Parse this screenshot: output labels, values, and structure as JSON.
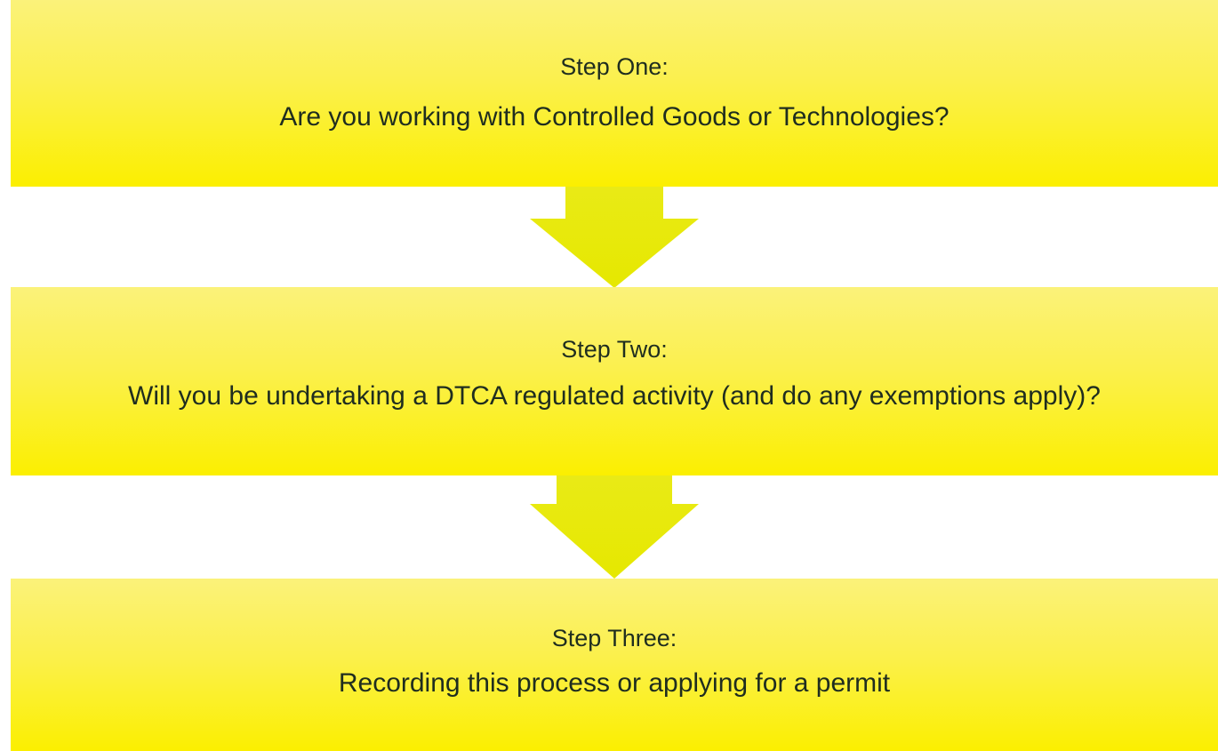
{
  "steps": [
    {
      "heading": "Step One:",
      "question": "Are you working with Controlled Goods or Technologies?"
    },
    {
      "heading": "Step Two:",
      "question": "Will you be undertaking a DTCA regulated activity (and do any exemptions apply)?"
    },
    {
      "heading": "Step Three:",
      "question": "Recording this process or applying for a permit"
    }
  ],
  "colors": {
    "box_fill": "#fbef00",
    "arrow_fill": "#e7e900",
    "text": "#1f2d1f"
  }
}
